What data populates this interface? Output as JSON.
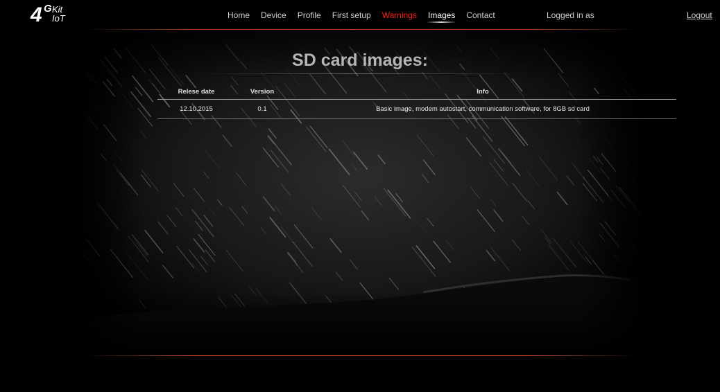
{
  "logo": {
    "number": "4",
    "g": "G",
    "kit": "Kit",
    "iot": "IoT"
  },
  "nav": {
    "items": [
      {
        "label": "Home",
        "state": "normal"
      },
      {
        "label": "Device",
        "state": "normal"
      },
      {
        "label": "Profile",
        "state": "normal"
      },
      {
        "label": "First setup",
        "state": "normal"
      },
      {
        "label": "Warnings",
        "state": "warning"
      },
      {
        "label": "Images",
        "state": "active"
      },
      {
        "label": "Contact",
        "state": "normal"
      }
    ],
    "logged_in": "Logged in as",
    "logout": "Logout"
  },
  "main": {
    "title": "SD card images:",
    "table": {
      "headers": [
        "Relese date",
        "Version",
        "Info"
      ],
      "rows": [
        [
          "12.10.2015",
          "0.1",
          "Basic image, modem autostart, communication software, for 8GB sd card"
        ]
      ]
    }
  },
  "colors": {
    "background": "#000000",
    "warning_link": "#ff1a1a",
    "separator": "#c8501e",
    "title": "#b5b5b5"
  }
}
